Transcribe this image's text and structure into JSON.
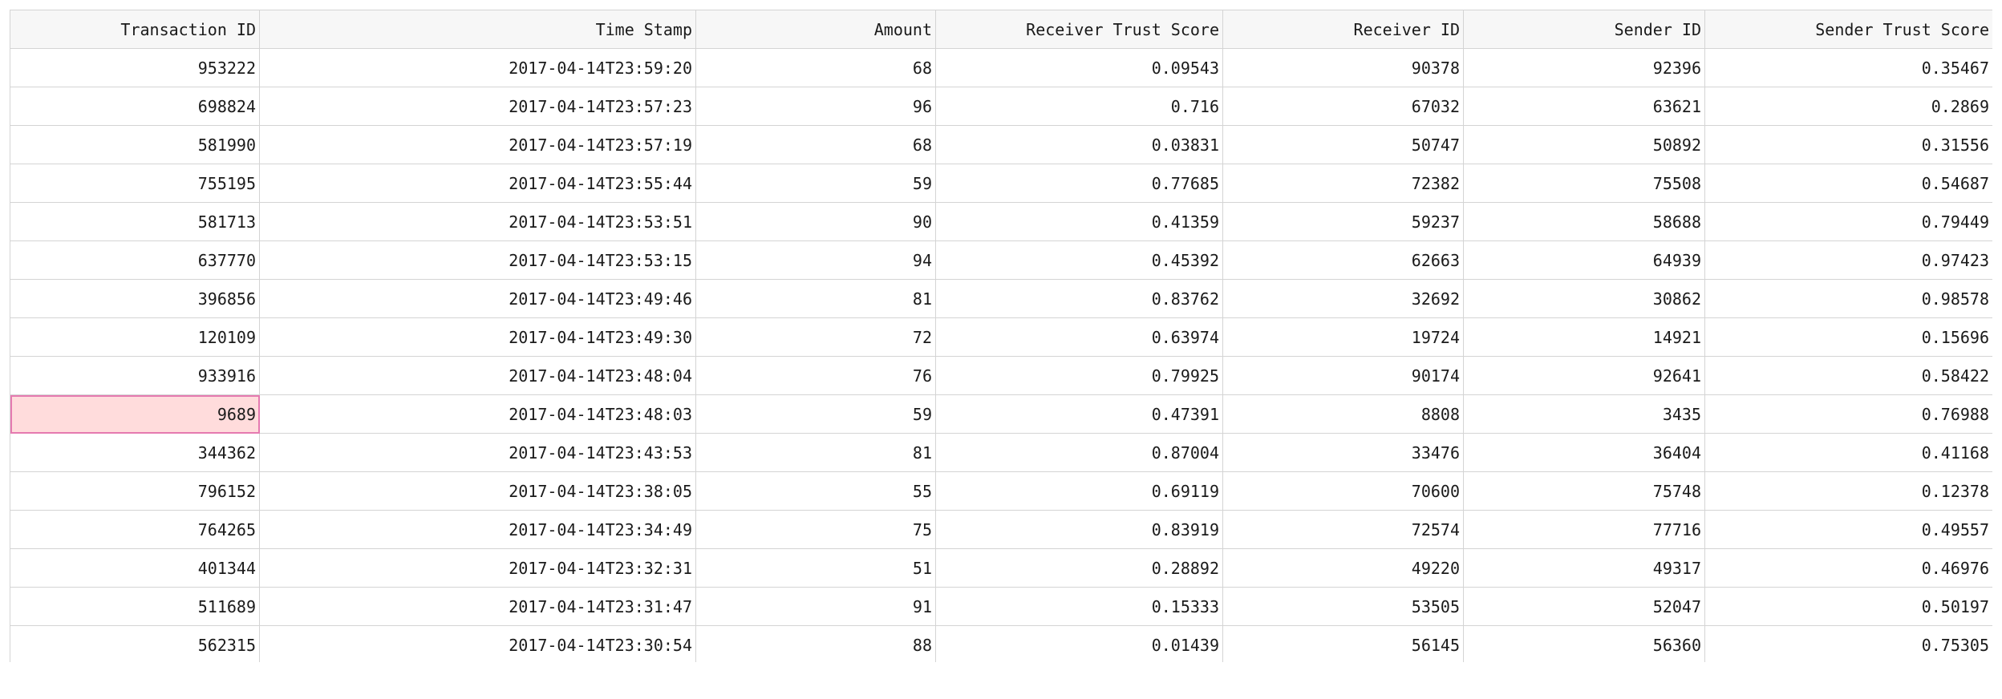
{
  "columns": [
    "Transaction ID",
    "Time Stamp",
    "Amount",
    "Receiver Trust Score",
    "Receiver ID",
    "Sender ID",
    "Sender Trust Score"
  ],
  "selected_cell": {
    "row": 9,
    "column": 0
  },
  "colors": {
    "header_bg": "#f7f7f7",
    "grid_line": "#d4d4d4",
    "selected_bg": "#ffdcdc",
    "selected_border": "#e57ab0"
  },
  "rows": [
    [
      "953222",
      "2017-04-14T23:59:20",
      "68",
      "0.09543",
      "90378",
      "92396",
      "0.35467"
    ],
    [
      "698824",
      "2017-04-14T23:57:23",
      "96",
      "0.716",
      "67032",
      "63621",
      "0.2869"
    ],
    [
      "581990",
      "2017-04-14T23:57:19",
      "68",
      "0.03831",
      "50747",
      "50892",
      "0.31556"
    ],
    [
      "755195",
      "2017-04-14T23:55:44",
      "59",
      "0.77685",
      "72382",
      "75508",
      "0.54687"
    ],
    [
      "581713",
      "2017-04-14T23:53:51",
      "90",
      "0.41359",
      "59237",
      "58688",
      "0.79449"
    ],
    [
      "637770",
      "2017-04-14T23:53:15",
      "94",
      "0.45392",
      "62663",
      "64939",
      "0.97423"
    ],
    [
      "396856",
      "2017-04-14T23:49:46",
      "81",
      "0.83762",
      "32692",
      "30862",
      "0.98578"
    ],
    [
      "120109",
      "2017-04-14T23:49:30",
      "72",
      "0.63974",
      "19724",
      "14921",
      "0.15696"
    ],
    [
      "933916",
      "2017-04-14T23:48:04",
      "76",
      "0.79925",
      "90174",
      "92641",
      "0.58422"
    ],
    [
      "9689",
      "2017-04-14T23:48:03",
      "59",
      "0.47391",
      "8808",
      "3435",
      "0.76988"
    ],
    [
      "344362",
      "2017-04-14T23:43:53",
      "81",
      "0.87004",
      "33476",
      "36404",
      "0.41168"
    ],
    [
      "796152",
      "2017-04-14T23:38:05",
      "55",
      "0.69119",
      "70600",
      "75748",
      "0.12378"
    ],
    [
      "764265",
      "2017-04-14T23:34:49",
      "75",
      "0.83919",
      "72574",
      "77716",
      "0.49557"
    ],
    [
      "401344",
      "2017-04-14T23:32:31",
      "51",
      "0.28892",
      "49220",
      "49317",
      "0.46976"
    ],
    [
      "511689",
      "2017-04-14T23:31:47",
      "91",
      "0.15333",
      "53505",
      "52047",
      "0.50197"
    ],
    [
      "562315",
      "2017-04-14T23:30:54",
      "88",
      "0.01439",
      "56145",
      "56360",
      "0.75305"
    ]
  ]
}
